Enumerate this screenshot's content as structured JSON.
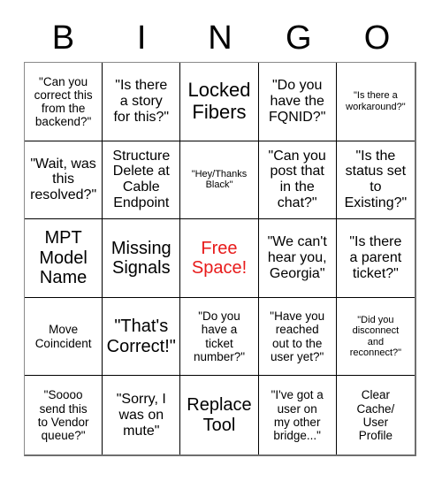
{
  "card": {
    "title": "BINGO",
    "header_letters": [
      "B",
      "I",
      "N",
      "G",
      "O"
    ],
    "free_space_color": "#e81b1b",
    "grid_size": "5x5",
    "cells": [
      {
        "text": "\"Can you\ncorrect this\nfrom the\nbackend?\"",
        "size": "sm",
        "free": false
      },
      {
        "text": "\"Is there\na story\nfor this?\"",
        "size": "md",
        "free": false
      },
      {
        "text": "Locked\nFibers",
        "size": "xl",
        "free": false
      },
      {
        "text": "\"Do you\nhave the\nFQNID?\"",
        "size": "md",
        "free": false
      },
      {
        "text": "\"Is there a\nworkaround?\"",
        "size": "xs",
        "free": false
      },
      {
        "text": "\"Wait, was\nthis\nresolved?\"",
        "size": "md",
        "free": false
      },
      {
        "text": "Structure\nDelete at\nCable\nEndpoint",
        "size": "md",
        "free": false
      },
      {
        "text": "\"Hey/Thanks\nBlack\"",
        "size": "xs",
        "free": false
      },
      {
        "text": "\"Can you\npost that\nin the\nchat?\"",
        "size": "md",
        "free": false
      },
      {
        "text": "\"Is the\nstatus set\nto\nExisting?\"",
        "size": "md",
        "free": false
      },
      {
        "text": "MPT\nModel\nName",
        "size": "lg",
        "free": false
      },
      {
        "text": "Missing\nSignals",
        "size": "lg",
        "free": false
      },
      {
        "text": "Free\nSpace!",
        "size": "lg",
        "free": true
      },
      {
        "text": "\"We can't\nhear you,\nGeorgia\"",
        "size": "md",
        "free": false
      },
      {
        "text": "\"Is there\na parent\nticket?\"",
        "size": "md",
        "free": false
      },
      {
        "text": "Move\nCoincident",
        "size": "sm",
        "free": false
      },
      {
        "text": "\"That's\nCorrect!\"",
        "size": "lg",
        "free": false
      },
      {
        "text": "\"Do you\nhave a\nticket\nnumber?\"",
        "size": "sm",
        "free": false
      },
      {
        "text": "\"Have you\nreached\nout to the\nuser yet?\"",
        "size": "sm",
        "free": false
      },
      {
        "text": "\"Did you\ndisconnect\nand\nreconnect?\"",
        "size": "xs",
        "free": false
      },
      {
        "text": "\"Soooo\nsend this\nto Vendor\nqueue?\"",
        "size": "sm",
        "free": false
      },
      {
        "text": "\"Sorry, I\nwas on\nmute\"",
        "size": "md",
        "free": false
      },
      {
        "text": "Replace\nTool",
        "size": "lg",
        "free": false
      },
      {
        "text": "\"I've got a\nuser on\nmy other\nbridge...\"",
        "size": "sm",
        "free": false
      },
      {
        "text": "Clear\nCache/\nUser\nProfile",
        "size": "sm",
        "free": false
      }
    ]
  }
}
